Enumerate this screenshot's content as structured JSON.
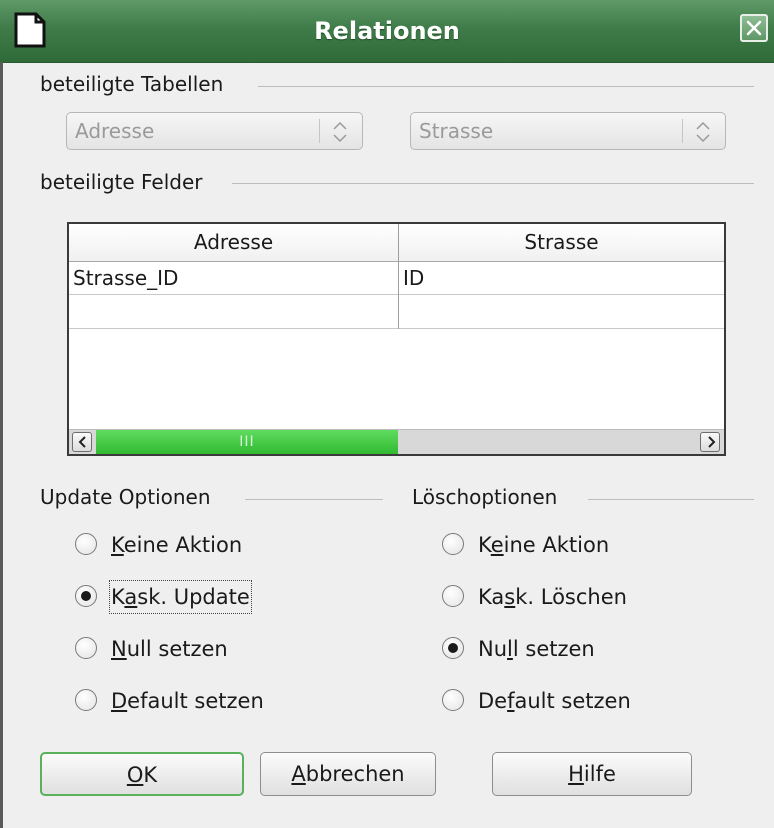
{
  "window": {
    "title": "Relationen",
    "accent": "#3f7c49"
  },
  "tables": {
    "section_label": "beteiligte Tabellen",
    "left_table": "Adresse",
    "right_table": "Strasse"
  },
  "fields": {
    "section_label": "beteiligte Felder",
    "columns": [
      "Adresse",
      "Strasse"
    ],
    "rows": [
      [
        "Strasse_ID",
        "ID"
      ],
      [
        "",
        ""
      ]
    ],
    "scroll_grip": "III"
  },
  "update_options": {
    "label": "Update Optionen",
    "options": [
      {
        "pre": "",
        "mnemonic": "K",
        "post": "eine Aktion",
        "selected": false
      },
      {
        "pre": "K",
        "mnemonic": "a",
        "post": "sk. Update",
        "selected": true
      },
      {
        "pre": "",
        "mnemonic": "N",
        "post": "ull setzen",
        "selected": false
      },
      {
        "pre": "",
        "mnemonic": "D",
        "post": "efault setzen",
        "selected": false
      }
    ]
  },
  "delete_options": {
    "label": "Löschoptionen",
    "options": [
      {
        "pre": "K",
        "mnemonic": "e",
        "post": "ine Aktion",
        "selected": false
      },
      {
        "pre": "Ka",
        "mnemonic": "s",
        "post": "k. Löschen",
        "selected": false
      },
      {
        "pre": "Nu",
        "mnemonic": "l",
        "post": "l setzen",
        "selected": true
      },
      {
        "pre": "De",
        "mnemonic": "f",
        "post": "ault setzen",
        "selected": false
      }
    ]
  },
  "buttons": {
    "ok": {
      "pre": "",
      "mnemonic": "O",
      "post": "K"
    },
    "cancel": {
      "pre": "",
      "mnemonic": "A",
      "post": "bbrechen"
    },
    "help": {
      "pre": "",
      "mnemonic": "H",
      "post": "ilfe"
    }
  },
  "icons": [
    "document-icon",
    "close-icon",
    "spin-icon",
    "scroll-left-icon",
    "scroll-right-icon"
  ]
}
